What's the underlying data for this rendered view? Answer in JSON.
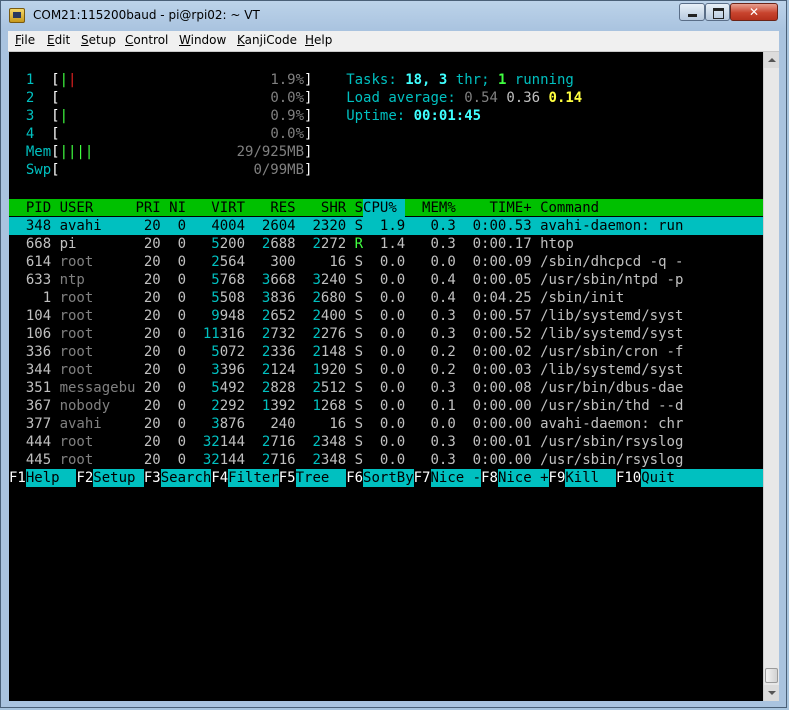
{
  "window": {
    "title": "COM21:115200baud - pi@rpi02: ~ VT"
  },
  "menu": [
    {
      "ul": "F",
      "rest": "ile"
    },
    {
      "ul": "E",
      "rest": "dit"
    },
    {
      "ul": "S",
      "rest": "etup"
    },
    {
      "ul": "C",
      "rest": "ontrol"
    },
    {
      "ul": "W",
      "rest": "indow"
    },
    {
      "ul": "K",
      "rest": "anjiCode"
    },
    {
      "ul": "H",
      "rest": "elp"
    }
  ],
  "meters": {
    "cpu": [
      {
        "id": "1",
        "bar": "||",
        "value": "1.9%"
      },
      {
        "id": "2",
        "bar": "",
        "value": "0.0%"
      },
      {
        "id": "3",
        "bar": "|",
        "value": "0.9%"
      },
      {
        "id": "4",
        "bar": "",
        "value": "0.0%"
      }
    ],
    "mem": {
      "label": "Mem",
      "bar": "||||",
      "value": "29/925MB"
    },
    "swp": {
      "label": "Swp",
      "bar": "",
      "value": "0/99MB"
    }
  },
  "summary": {
    "tasks_label": "Tasks:",
    "tasks": "18,",
    "threads": "3",
    "threads_label": "thr;",
    "running": "1",
    "running_label": "running",
    "load_label": "Load average:",
    "load1": "0.54",
    "load5": "0.36",
    "load15": "0.14",
    "uptime_label": "Uptime:",
    "uptime": "00:01:45"
  },
  "columns": [
    "PID",
    "USER",
    "PRI",
    "NI",
    "VIRT",
    "RES",
    "SHR",
    "S",
    "CPU%",
    "MEM%",
    "TIME+",
    "Command"
  ],
  "processes": [
    {
      "pid": "348",
      "user": "avahi",
      "pri": "20",
      "ni": "0",
      "virt": "4004",
      "res": "2604",
      "shr": "2320",
      "s": "S",
      "cpu": "1.9",
      "mem": "0.3",
      "time": "0:00.53",
      "cmd": "avahi-daemon: run"
    },
    {
      "pid": "668",
      "user": "pi",
      "pri": "20",
      "ni": "0",
      "virt": "5200",
      "res": "2688",
      "shr": "2272",
      "s": "R",
      "cpu": "1.4",
      "mem": "0.3",
      "time": "0:00.17",
      "cmd": "htop"
    },
    {
      "pid": "614",
      "user": "root",
      "pri": "20",
      "ni": "0",
      "virt": "2564",
      "res": "300",
      "shr": "16",
      "s": "S",
      "cpu": "0.0",
      "mem": "0.0",
      "time": "0:00.09",
      "cmd": "/sbin/dhcpcd -q -"
    },
    {
      "pid": "633",
      "user": "ntp",
      "pri": "20",
      "ni": "0",
      "virt": "5768",
      "res": "3668",
      "shr": "3240",
      "s": "S",
      "cpu": "0.0",
      "mem": "0.4",
      "time": "0:00.05",
      "cmd": "/usr/sbin/ntpd -p"
    },
    {
      "pid": "1",
      "user": "root",
      "pri": "20",
      "ni": "0",
      "virt": "5508",
      "res": "3836",
      "shr": "2680",
      "s": "S",
      "cpu": "0.0",
      "mem": "0.4",
      "time": "0:04.25",
      "cmd": "/sbin/init"
    },
    {
      "pid": "104",
      "user": "root",
      "pri": "20",
      "ni": "0",
      "virt": "9948",
      "res": "2652",
      "shr": "2400",
      "s": "S",
      "cpu": "0.0",
      "mem": "0.3",
      "time": "0:00.57",
      "cmd": "/lib/systemd/syst"
    },
    {
      "pid": "106",
      "user": "root",
      "pri": "20",
      "ni": "0",
      "virt": "11316",
      "res": "2732",
      "shr": "2276",
      "s": "S",
      "cpu": "0.0",
      "mem": "0.3",
      "time": "0:00.52",
      "cmd": "/lib/systemd/syst"
    },
    {
      "pid": "336",
      "user": "root",
      "pri": "20",
      "ni": "0",
      "virt": "5072",
      "res": "2336",
      "shr": "2148",
      "s": "S",
      "cpu": "0.0",
      "mem": "0.2",
      "time": "0:00.02",
      "cmd": "/usr/sbin/cron -f"
    },
    {
      "pid": "344",
      "user": "root",
      "pri": "20",
      "ni": "0",
      "virt": "3396",
      "res": "2124",
      "shr": "1920",
      "s": "S",
      "cpu": "0.0",
      "mem": "0.2",
      "time": "0:00.03",
      "cmd": "/lib/systemd/syst"
    },
    {
      "pid": "351",
      "user": "messagebu",
      "pri": "20",
      "ni": "0",
      "virt": "5492",
      "res": "2828",
      "shr": "2512",
      "s": "S",
      "cpu": "0.0",
      "mem": "0.3",
      "time": "0:00.08",
      "cmd": "/usr/bin/dbus-dae"
    },
    {
      "pid": "367",
      "user": "nobody",
      "pri": "20",
      "ni": "0",
      "virt": "2292",
      "res": "1392",
      "shr": "1268",
      "s": "S",
      "cpu": "0.0",
      "mem": "0.1",
      "time": "0:00.00",
      "cmd": "/usr/sbin/thd --d"
    },
    {
      "pid": "377",
      "user": "avahi",
      "pri": "20",
      "ni": "0",
      "virt": "3876",
      "res": "240",
      "shr": "16",
      "s": "S",
      "cpu": "0.0",
      "mem": "0.0",
      "time": "0:00.00",
      "cmd": "avahi-daemon: chr"
    },
    {
      "pid": "444",
      "user": "root",
      "pri": "20",
      "ni": "0",
      "virt": "32144",
      "res": "2716",
      "shr": "2348",
      "s": "S",
      "cpu": "0.0",
      "mem": "0.3",
      "time": "0:00.01",
      "cmd": "/usr/sbin/rsyslog"
    },
    {
      "pid": "445",
      "user": "root",
      "pri": "20",
      "ni": "0",
      "virt": "32144",
      "res": "2716",
      "shr": "2348",
      "s": "S",
      "cpu": "0.0",
      "mem": "0.3",
      "time": "0:00.00",
      "cmd": "/usr/sbin/rsyslog"
    }
  ],
  "fkeys": [
    {
      "key": "F1",
      "label": "Help  "
    },
    {
      "key": "F2",
      "label": "Setup "
    },
    {
      "key": "F3",
      "label": "Search"
    },
    {
      "key": "F4",
      "label": "Filter"
    },
    {
      "key": "F5",
      "label": "Tree  "
    },
    {
      "key": "F6",
      "label": "SortBy"
    },
    {
      "key": "F7",
      "label": "Nice -"
    },
    {
      "key": "F8",
      "label": "Nice +"
    },
    {
      "key": "F9",
      "label": "Kill  "
    },
    {
      "key": "F10",
      "label": "Quit  "
    }
  ],
  "colors": {
    "terminal_bg": "#000000",
    "text": "#c0c0c0",
    "cyan": "#00c0c0",
    "bright_cyan": "#40ffff",
    "green": "#00c000",
    "bright_green": "#40ff40",
    "yellow": "#ffff40",
    "red": "#e02020",
    "gray": "#808080",
    "white": "#ffffff",
    "header_bg": "#00c000",
    "selected_bg": "#00c0c0"
  }
}
